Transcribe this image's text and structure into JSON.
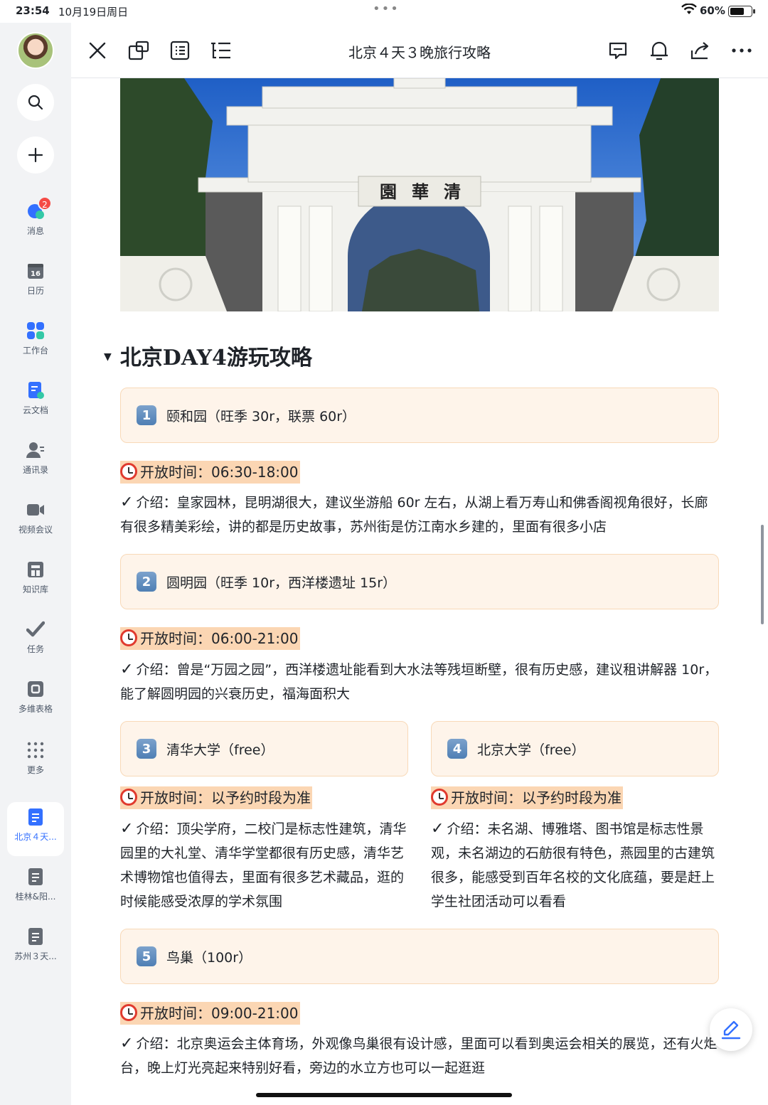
{
  "status_bar": {
    "time": "23:54",
    "date": "10月19日周日",
    "battery": "60%"
  },
  "sidebar": {
    "badge_count": "2",
    "items": [
      {
        "label": "消息"
      },
      {
        "label": "日历",
        "calendar_day": "16"
      },
      {
        "label": "工作台"
      },
      {
        "label": "云文档"
      },
      {
        "label": "通讯录"
      },
      {
        "label": "视频会议"
      },
      {
        "label": "知识库"
      },
      {
        "label": "任务"
      },
      {
        "label": "多维表格"
      },
      {
        "label": "更多"
      }
    ],
    "recent_docs": [
      {
        "label": "北京４天...",
        "active": true
      },
      {
        "label": "桂林&阳..."
      },
      {
        "label": "苏州３天..."
      }
    ]
  },
  "toolbar": {
    "title": "北京４天３晚旅行攻略"
  },
  "content": {
    "heading": "北京DAY4游玩攻略",
    "spots": [
      {
        "num": "1",
        "name": "颐和园（旺季 30r，联票 60r）",
        "hours": "开放时间：06:30-18:00",
        "intro": "介绍：皇家园林，昆明湖很大，建议坐游船 60r 左右，从湖上看万寿山和佛香阁视角很好，长廊有很多精美彩绘，讲的都是历史故事，苏州街是仿江南水乡建的，里面有很多小店"
      },
      {
        "num": "2",
        "name": "圆明园（旺季 10r，西洋楼遗址 15r）",
        "hours": "开放时间：06:00-21:00",
        "intro": "介绍：曾是“万园之园”，西洋楼遗址能看到大水法等残垣断壁，很有历史感，建议租讲解器 10r，能了解圆明园的兴衰历史，福海面积大"
      },
      {
        "num": "3",
        "name": "清华大学（free）",
        "hours": "开放时间：以予约时段为准",
        "intro": "介绍：顶尖学府，二校门是标志性建筑，清华园里的大礼堂、清华学堂都很有历史感，清华艺术博物馆也值得去，里面有很多艺术藏品，逛的时候能感受浓厚的学术氛围"
      },
      {
        "num": "4",
        "name": "北京大学（free）",
        "hours": "开放时间：以予约时段为准",
        "intro": "介绍：未名湖、博雅塔、图书馆是标志性景观，未名湖边的石舫很有特色，燕园里的古建筑很多，能感受到百年名校的文化底蕴，要是赶上学生社团活动可以看看"
      },
      {
        "num": "5",
        "name": "鸟巢（100r）",
        "hours": "开放时间：09:00-21:00",
        "intro": "介绍：北京奥运会主体育场，外观像鸟巢很有设计感，里面可以看到奥运会相关的展览，还有火炬台，晚上灯光亮起来特别好看，旁边的水立方也可以一起逛逛"
      }
    ],
    "gate_plaque": {
      "chars": [
        "清",
        "華",
        "園"
      ]
    }
  },
  "colors": {
    "accent": "#3370ff",
    "callout_bg": "#fef4ea",
    "callout_border": "#f8d9b8",
    "highlight": "#fbd6b3",
    "badge": "#f54a45"
  }
}
